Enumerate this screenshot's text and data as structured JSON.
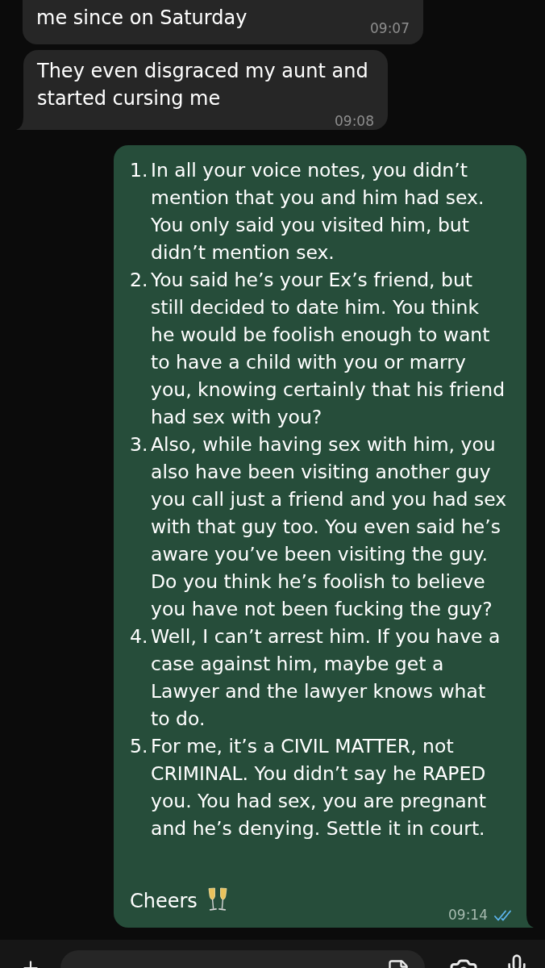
{
  "messages": [
    {
      "kind": "text",
      "outgoing": false,
      "clipped_top": true,
      "tail": false,
      "text": "me since on Saturday",
      "time": "09:07"
    },
    {
      "kind": "text",
      "outgoing": false,
      "clipped_top": false,
      "tail": true,
      "text": "They even disgraced my aunt and\nstarted cursing me",
      "time": "09:08"
    },
    {
      "kind": "list",
      "outgoing": true,
      "clipped_top": false,
      "tail": true,
      "items": [
        {
          "number": "1.",
          "text": "In all your voice notes, you didn’t\nmention that you and him had sex.\nYou only said you visited him, but\ndidn’t mention sex."
        },
        {
          "number": "2.",
          "text": "You said he’s your Ex’s friend, but\nstill decided to date him. You think\nhe would be foolish enough to want\nto have a child with you or marry\nyou, knowing certainly that his friend\nhad sex with you?"
        },
        {
          "number": "3.",
          "text": "Also, while having sex with him, you\nalso have been visiting another guy\nyou call just a friend and you had sex\nwith that guy too. You even said he’s\naware you’ve been visiting the guy.\nDo you think he’s foolish to believe\nyou have not been fucking the guy?"
        },
        {
          "number": "4.",
          "text": "Well, I can’t arrest him. If you have a\ncase against him, maybe get a\nLawyer and the lawyer knows what\nto do."
        },
        {
          "number": "5.",
          "text": "For me, it’s a CIVIL MATTER, not\nCRIMINAL. You didn’t say he RAPED\nyou. You had sex, you are pregnant\nand he’s denying. Settle it in court."
        }
      ],
      "closing": "Cheers",
      "time": "09:14",
      "read": true
    }
  ]
}
